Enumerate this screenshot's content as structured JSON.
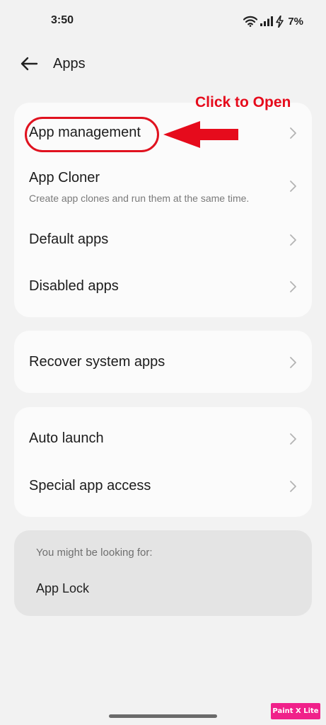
{
  "status_bar": {
    "time": "3:50",
    "battery": "7%",
    "icons": [
      "wifi-icon",
      "signal-icon",
      "charging-bolt-icon"
    ]
  },
  "header": {
    "back_icon": "arrow-left-icon",
    "title": "Apps"
  },
  "annotation": {
    "text": "Click to Open",
    "color": "#e60b1c"
  },
  "groups": [
    {
      "items": [
        {
          "title": "App management"
        },
        {
          "title": "App Cloner",
          "subtitle": "Create app clones and run them at the same time."
        },
        {
          "title": "Default apps"
        },
        {
          "title": "Disabled apps"
        }
      ]
    },
    {
      "items": [
        {
          "title": "Recover system apps"
        }
      ]
    },
    {
      "items": [
        {
          "title": "Auto launch"
        },
        {
          "title": "Special app access"
        }
      ]
    }
  ],
  "suggestions": {
    "label": "You might be looking for:",
    "items": [
      "App Lock"
    ]
  },
  "watermark": "Paint X Lite"
}
